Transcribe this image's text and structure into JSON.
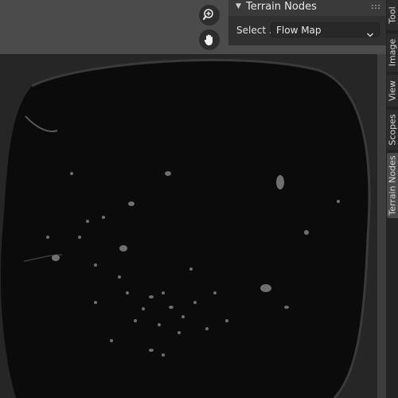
{
  "panel": {
    "title": "Terrain Nodes",
    "select_label": "Select ...",
    "select_value": "Flow Map"
  },
  "tabs": [
    {
      "label": "Tool",
      "active": false
    },
    {
      "label": "Image",
      "active": false
    },
    {
      "label": "View",
      "active": false
    },
    {
      "label": "Scopes",
      "active": false
    },
    {
      "label": "Terrain Nodes",
      "active": true
    }
  ],
  "icons": {
    "zoom": "zoom-in-icon",
    "pan": "hand-pan-icon",
    "collapse": "disclosure-triangle-icon",
    "dropdown": "chevron-down-icon"
  },
  "colors": {
    "viewport_bg": "#1c1c1c",
    "image_dark": "#0a0a0a",
    "flow_mark": "#8a8a8a"
  }
}
